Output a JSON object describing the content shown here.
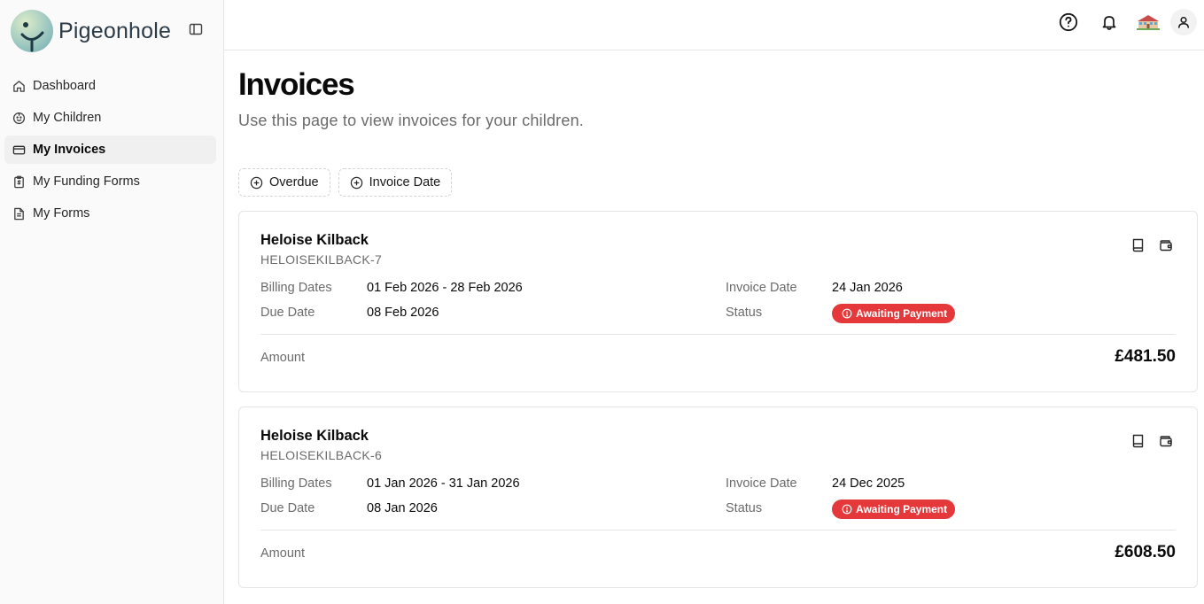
{
  "app": {
    "name": "Pigeonhole"
  },
  "sidebar": {
    "items": [
      {
        "label": "Dashboard",
        "icon": "home-icon",
        "active": false
      },
      {
        "label": "My Children",
        "icon": "baby-icon",
        "active": false
      },
      {
        "label": "My Invoices",
        "icon": "credit-card-icon",
        "active": true
      },
      {
        "label": "My Funding Forms",
        "icon": "clipboard-money-icon",
        "active": false
      },
      {
        "label": "My Forms",
        "icon": "file-text-icon",
        "active": false
      }
    ]
  },
  "header": {
    "icons": [
      "help-icon",
      "bell-icon",
      "school-icon",
      "user-icon"
    ]
  },
  "page": {
    "title": "Invoices",
    "subtitle": "Use this page to view invoices for your children."
  },
  "filters": [
    {
      "label": "Overdue"
    },
    {
      "label": "Invoice Date"
    }
  ],
  "labels": {
    "billing_dates": "Billing Dates",
    "due_date": "Due Date",
    "invoice_date": "Invoice Date",
    "status": "Status",
    "amount": "Amount"
  },
  "invoices": [
    {
      "child_name": "Heloise Kilback",
      "reference": "HELOISEKILBACK-7",
      "billing_dates": "01 Feb 2026 - 28 Feb 2026",
      "due_date": "08 Feb 2026",
      "invoice_date": "24 Jan 2026",
      "status": "Awaiting Payment",
      "amount": "£481.50"
    },
    {
      "child_name": "Heloise Kilback",
      "reference": "HELOISEKILBACK-6",
      "billing_dates": "01 Jan 2026 - 31 Jan 2026",
      "due_date": "08 Jan 2026",
      "invoice_date": "24 Dec 2025",
      "status": "Awaiting Payment",
      "amount": "£608.50"
    }
  ],
  "colors": {
    "status_awaiting": "#e5383b",
    "active_nav_bg": "#f0f0f0",
    "sidebar_bg": "#fafafa"
  }
}
